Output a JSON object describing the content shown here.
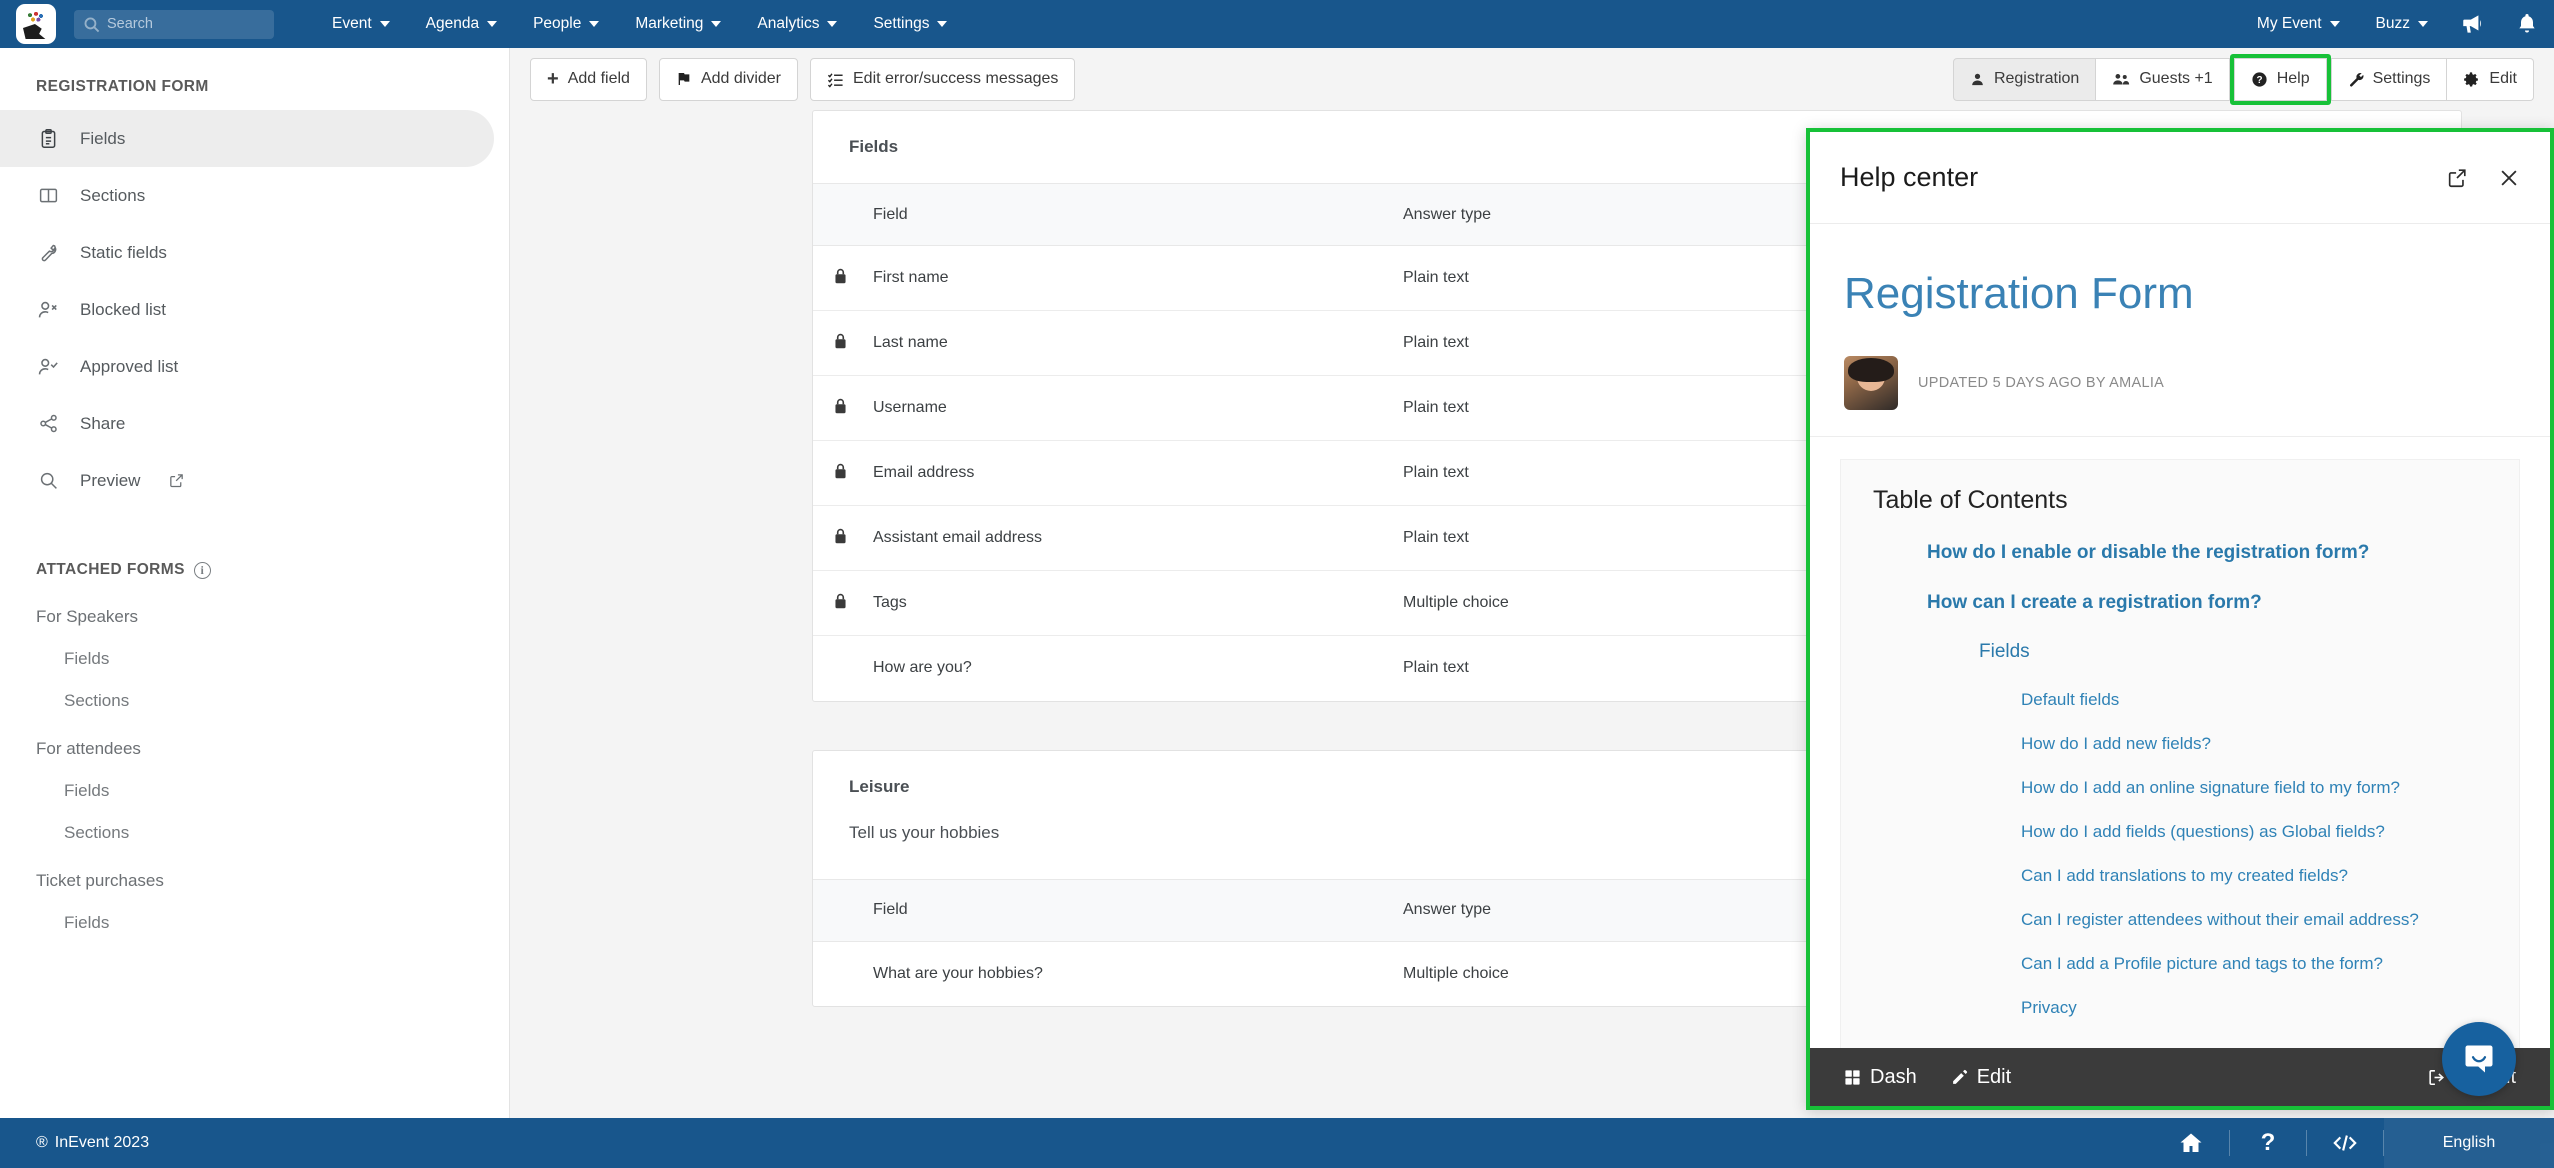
{
  "topnav": {
    "logo_name": "inevent-logo",
    "search": {
      "placeholder": "Search",
      "value": ""
    },
    "menus": [
      {
        "label": "Event"
      },
      {
        "label": "Agenda"
      },
      {
        "label": "People"
      },
      {
        "label": "Marketing"
      },
      {
        "label": "Analytics"
      },
      {
        "label": "Settings"
      }
    ],
    "right_menus": [
      {
        "label": "My Event"
      },
      {
        "label": "Buzz"
      }
    ],
    "right_icons": [
      {
        "name": "megaphone-icon"
      },
      {
        "name": "bell-icon"
      }
    ]
  },
  "sidebar": {
    "title": "REGISTRATION FORM",
    "items": [
      {
        "label": "Fields",
        "icon": "clipboard-icon",
        "active": true
      },
      {
        "label": "Sections",
        "icon": "columns-icon",
        "active": false
      },
      {
        "label": "Static fields",
        "icon": "wrench-icon",
        "active": false
      },
      {
        "label": "Blocked list",
        "icon": "user-x-icon",
        "active": false
      },
      {
        "label": "Approved list",
        "icon": "user-check-icon",
        "active": false
      },
      {
        "label": "Share",
        "icon": "share-icon",
        "active": false
      },
      {
        "label": "Preview",
        "icon": "search-icon",
        "active": false,
        "external": true
      }
    ],
    "attached_title": "ATTACHED FORMS",
    "attached_info_icon": "info-icon",
    "attached_groups": [
      {
        "label": "For Speakers",
        "children": [
          "Fields",
          "Sections"
        ]
      },
      {
        "label": "For attendees",
        "children": [
          "Fields",
          "Sections"
        ]
      },
      {
        "label": "Ticket purchases",
        "children": [
          "Fields"
        ]
      }
    ]
  },
  "toolbar": {
    "left_buttons": [
      {
        "label": "Add field",
        "icon": "plus-icon"
      },
      {
        "label": "Add divider",
        "icon": "flag-icon"
      },
      {
        "label": "Edit error/success messages",
        "icon": "list-check-icon"
      }
    ],
    "right_buttons": [
      {
        "label": "Registration",
        "icon": "user-icon",
        "selected": true,
        "highlighted": false
      },
      {
        "label": "Guests +1",
        "icon": "users-icon",
        "selected": false,
        "highlighted": false
      },
      {
        "label": "Help",
        "icon": "question-circle-icon",
        "selected": false,
        "highlighted": true
      },
      {
        "label": "Settings",
        "icon": "wrench-icon",
        "selected": false,
        "highlighted": false
      },
      {
        "label": "Edit",
        "icon": "gear-icon",
        "selected": false,
        "highlighted": false
      }
    ],
    "highlight_color": "#17c138"
  },
  "main": {
    "cards": [
      {
        "title": "Fields",
        "subtitle": "",
        "columns": [
          "Field",
          "Answer type"
        ],
        "rows": [
          {
            "locked": true,
            "field": "First name",
            "answer_type": "Plain text"
          },
          {
            "locked": true,
            "field": "Last name",
            "answer_type": "Plain text"
          },
          {
            "locked": true,
            "field": "Username",
            "answer_type": "Plain text"
          },
          {
            "locked": true,
            "field": "Email address",
            "answer_type": "Plain text"
          },
          {
            "locked": true,
            "field": "Assistant email address",
            "answer_type": "Plain text"
          },
          {
            "locked": true,
            "field": "Tags",
            "answer_type": "Multiple choice"
          },
          {
            "locked": false,
            "field": "How are you?",
            "answer_type": "Plain text"
          }
        ]
      },
      {
        "title": "Leisure",
        "subtitle": "Tell us your hobbies",
        "columns": [
          "Field",
          "Answer type"
        ],
        "rows": [
          {
            "locked": false,
            "field": "What are your hobbies?",
            "answer_type": "Multiple choice"
          }
        ]
      }
    ]
  },
  "help_panel": {
    "title": "Help center",
    "open_external_icon": "external-link-icon",
    "close_icon": "close-icon",
    "article_title": "Registration Form",
    "article_title_color": "#3a82b5",
    "meta": "UPDATED 5 DAYS AGO BY AMALIA",
    "avatar_name": "author-avatar",
    "toc_title": "Table of Contents",
    "toc": [
      {
        "level": 1,
        "label": "How do I enable or disable the registration form?"
      },
      {
        "level": 1,
        "label": "How can I create a registration form?"
      },
      {
        "level": 2,
        "label": "Fields"
      },
      {
        "level": 3,
        "label": "Default fields"
      },
      {
        "level": 3,
        "label": "How do I add new fields?"
      },
      {
        "level": 3,
        "label": "How do I add an online signature field to my form?"
      },
      {
        "level": 3,
        "label": "How do I add fields (questions) as Global fields?"
      },
      {
        "level": 3,
        "label": "Can I add translations to my created fields?"
      },
      {
        "level": 3,
        "label": "Can I register attendees without their email address?"
      },
      {
        "level": 3,
        "label": "Can I add a Profile picture and tags to the form?"
      },
      {
        "level": 3,
        "label": "Privacy"
      }
    ],
    "footer": {
      "dash": "Dash",
      "edit": "Edit",
      "logout": "Logout"
    }
  },
  "chat_widget": {
    "name": "chat-bubble-icon"
  },
  "footer": {
    "copyright": "InEvent 2023",
    "registered_mark": "®",
    "icons": [
      {
        "name": "home-icon"
      },
      {
        "name": "question-icon"
      },
      {
        "name": "code-icon"
      }
    ],
    "language": "English"
  }
}
